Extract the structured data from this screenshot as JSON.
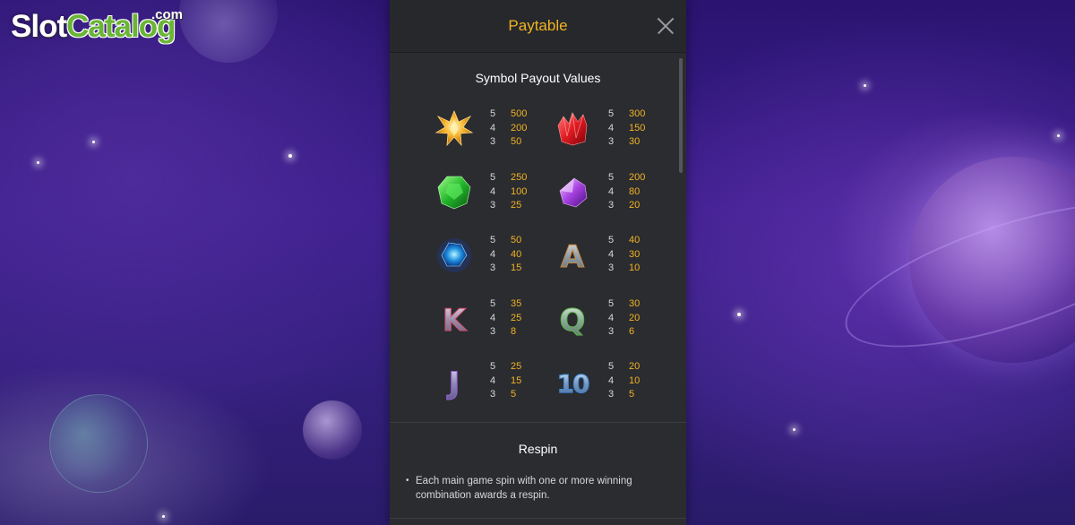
{
  "logo": {
    "main_slot": "Slot",
    "main_catalog": "Catalog",
    "suffix": ".com"
  },
  "paytable": {
    "title": "Paytable",
    "close_icon": "close-icon",
    "symbol_section_title": "Symbol Payout Values",
    "symbols": [
      {
        "name": "yellow-crystal",
        "icon": "yellow-crystal-icon",
        "payouts": [
          {
            "count": "5",
            "value": "500"
          },
          {
            "count": "4",
            "value": "200"
          },
          {
            "count": "3",
            "value": "50"
          }
        ]
      },
      {
        "name": "red-crystal",
        "icon": "red-crystal-icon",
        "payouts": [
          {
            "count": "5",
            "value": "300"
          },
          {
            "count": "4",
            "value": "150"
          },
          {
            "count": "3",
            "value": "30"
          }
        ]
      },
      {
        "name": "green-crystal",
        "icon": "green-crystal-icon",
        "payouts": [
          {
            "count": "5",
            "value": "250"
          },
          {
            "count": "4",
            "value": "100"
          },
          {
            "count": "3",
            "value": "25"
          }
        ]
      },
      {
        "name": "purple-crystal",
        "icon": "purple-crystal-icon",
        "payouts": [
          {
            "count": "5",
            "value": "200"
          },
          {
            "count": "4",
            "value": "80"
          },
          {
            "count": "3",
            "value": "20"
          }
        ]
      },
      {
        "name": "blue-crystal",
        "icon": "blue-crystal-icon",
        "payouts": [
          {
            "count": "5",
            "value": "50"
          },
          {
            "count": "4",
            "value": "40"
          },
          {
            "count": "3",
            "value": "15"
          }
        ]
      },
      {
        "name": "letter-a",
        "icon": "letter-a-icon",
        "glyph": "A",
        "payouts": [
          {
            "count": "5",
            "value": "40"
          },
          {
            "count": "4",
            "value": "30"
          },
          {
            "count": "3",
            "value": "10"
          }
        ]
      },
      {
        "name": "letter-k",
        "icon": "letter-k-icon",
        "glyph": "K",
        "payouts": [
          {
            "count": "5",
            "value": "35"
          },
          {
            "count": "4",
            "value": "25"
          },
          {
            "count": "3",
            "value": "8"
          }
        ]
      },
      {
        "name": "letter-q",
        "icon": "letter-q-icon",
        "glyph": "Q",
        "payouts": [
          {
            "count": "5",
            "value": "30"
          },
          {
            "count": "4",
            "value": "20"
          },
          {
            "count": "3",
            "value": "6"
          }
        ]
      },
      {
        "name": "letter-j",
        "icon": "letter-j-icon",
        "glyph": "J",
        "payouts": [
          {
            "count": "5",
            "value": "25"
          },
          {
            "count": "4",
            "value": "15"
          },
          {
            "count": "3",
            "value": "5"
          }
        ]
      },
      {
        "name": "number-10",
        "icon": "number-10-icon",
        "glyph": "10",
        "payouts": [
          {
            "count": "5",
            "value": "20"
          },
          {
            "count": "4",
            "value": "10"
          },
          {
            "count": "3",
            "value": "5"
          }
        ]
      }
    ],
    "respin_title": "Respin",
    "respin_bullet": "•",
    "respin_text": "Each main game spin with one or more winning combination awards a respin."
  },
  "colors": {
    "accent": "#f0b323",
    "panel_bg": "#2b2c30",
    "header_bg": "#27282c",
    "text": "#d8d8dc"
  }
}
